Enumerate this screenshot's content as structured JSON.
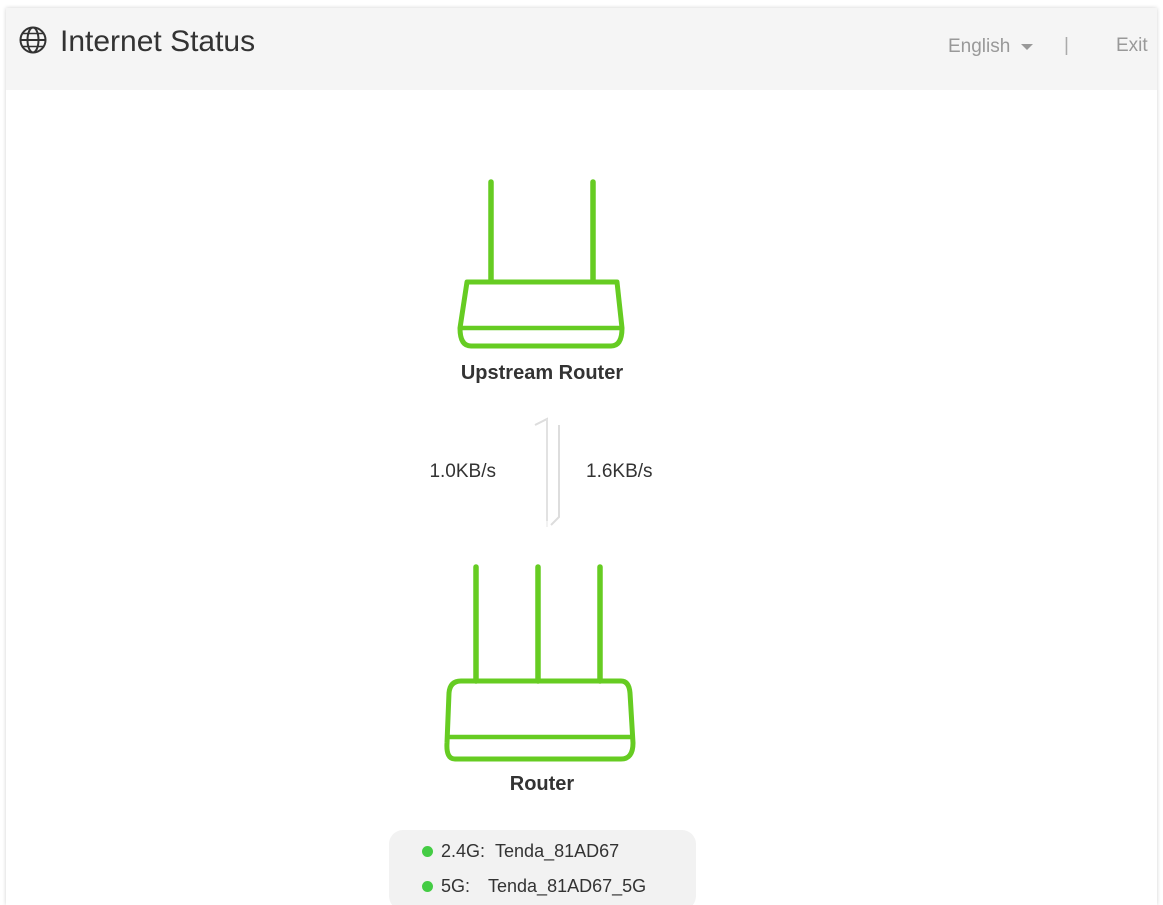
{
  "header": {
    "title": "Internet Status",
    "icon": "globe-icon",
    "language": "English",
    "separator": "|",
    "exit_label": "Exit"
  },
  "topology": {
    "upstream_label": "Upstream Router",
    "router_label": "Router",
    "upload_rate": "1.0KB/s",
    "download_rate": "1.6KB/s"
  },
  "wifi": [
    {
      "band": "2.4G:",
      "ssid": "Tenda_81AD67",
      "status": "online"
    },
    {
      "band": "5G:",
      "ssid": "Tenda_81AD67_5G",
      "status": "online"
    }
  ],
  "colors": {
    "accent_green": "#66cc22",
    "status_dot": "#44cc44",
    "header_bg": "#f5f5f5",
    "arrow_gray": "#dddddd"
  }
}
